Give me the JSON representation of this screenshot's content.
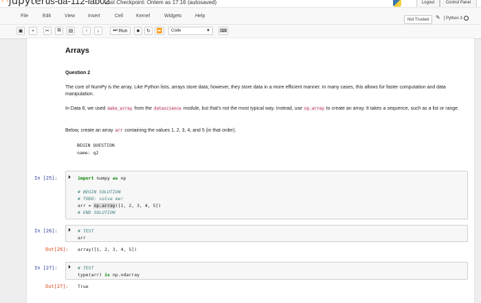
{
  "header": {
    "logo_text": "jupyter",
    "notebook_name": "us-da-112-lab02",
    "checkpoint": "Last Checkpoint: Ontem as 17:16  (autosaved)",
    "logout_label": "Logout",
    "control_panel_label": "Control Panel"
  },
  "menubar": {
    "items": [
      "File",
      "Edit",
      "View",
      "Insert",
      "Cell",
      "Kernel",
      "Widgets",
      "Help"
    ],
    "trusted_label": "Not Trusted",
    "kernel_name": "Python 3"
  },
  "toolbar": {
    "run_label": "Run",
    "cell_type": "Code"
  },
  "markdown": {
    "title": "Arrays",
    "question": "Question 2",
    "p1": "The core of NumPy is the array. Like Python lists, arrays store data; however, they store data in a more efficient manner. In many cases, this allows for faster computation and data manipulation.",
    "p2_a": "In Data 8, we used ",
    "p2_code1": "make_array",
    "p2_b": " from the ",
    "p2_code2": "datascience",
    "p2_c": " module, but that's not the most typical way. Instead, use ",
    "p2_code3": "np.array",
    "p2_d": " to create an array. It takes a sequence, such as a list or range.",
    "p3_a": "Below, create an array ",
    "p3_code": "arr",
    "p3_b": " containing the values 1, 2, 3, 4, and 5 (in that order).",
    "pre1": "BEGIN QUESTION",
    "pre2": "name: q2"
  },
  "cells": [
    {
      "prompt": "In [25]:",
      "lines": {
        "kw1": "import",
        "mod": " numpy ",
        "kw2": "as",
        "alias": " np",
        "c1": "# BEGIN SOLUTION",
        "c2": "# TODO: solve me!",
        "assign": "arr = ",
        "call": "np.array",
        "args": "([1, 2, 3, 4, 5])",
        "c3": "# END SOLUTION"
      }
    },
    {
      "prompt": "In [26]:",
      "lines": {
        "c1": "# TEST",
        "code": "arr"
      },
      "out_prompt": "Out[26]:",
      "output": "array([1, 2, 3, 4, 5])"
    },
    {
      "prompt": "In [27]:",
      "lines": {
        "c1": "# TEST",
        "code_a": "type(arr) ",
        "kw": "is",
        "code_b": " np.ndarray"
      },
      "out_prompt": "Out[27]:",
      "output": "True"
    }
  ]
}
